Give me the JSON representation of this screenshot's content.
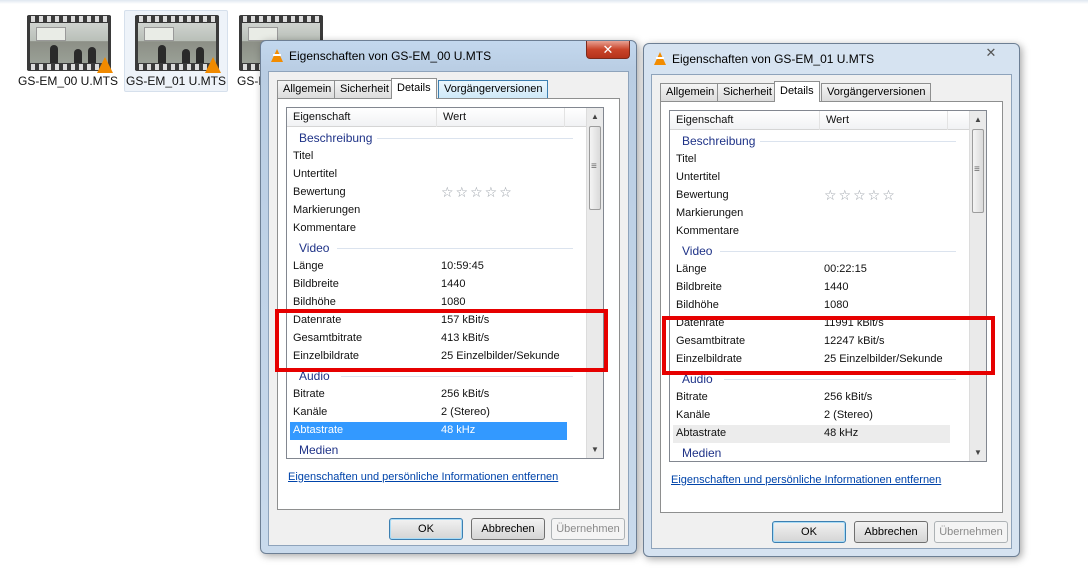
{
  "explorer": {
    "files": [
      {
        "name": "GS-EM_00 U.MTS"
      },
      {
        "name": "GS-EM_01 U.MTS"
      },
      {
        "name": "GS-E"
      }
    ]
  },
  "colors": {
    "highlight_box": "#e60000",
    "selection": "#3399ff",
    "group_header": "#1e3287",
    "link": "#0044aa"
  },
  "dialog_left": {
    "title": "Eigenschaften von GS-EM_00 U.MTS",
    "close_label": "✕",
    "tabs": [
      "Allgemein",
      "Sicherheit",
      "Details",
      "Vorgängerversionen"
    ],
    "selected_tab": "Details",
    "columns": [
      "Eigenschaft",
      "Wert"
    ],
    "groups": {
      "beschreibung": "Beschreibung",
      "video": "Video",
      "audio": "Audio",
      "medien": "Medien"
    },
    "beschreibung_rows": [
      {
        "k": "Titel",
        "v": ""
      },
      {
        "k": "Untertitel",
        "v": ""
      },
      {
        "k": "Bewertung",
        "v": ""
      },
      {
        "k": "Markierungen",
        "v": ""
      },
      {
        "k": "Kommentare",
        "v": ""
      }
    ],
    "rating_stars": "☆☆☆☆☆",
    "video_rows": [
      {
        "k": "Länge",
        "v": "10:59:45"
      },
      {
        "k": "Bildbreite",
        "v": "1440"
      },
      {
        "k": "Bildhöhe",
        "v": "1080"
      },
      {
        "k": "Datenrate",
        "v": "157 kBit/s"
      },
      {
        "k": "Gesamtbitrate",
        "v": "413 kBit/s"
      },
      {
        "k": "Einzelbildrate",
        "v": "25 Einzelbilder/Sekunde"
      }
    ],
    "audio_rows": [
      {
        "k": "Bitrate",
        "v": "256 kBit/s"
      },
      {
        "k": "Kanäle",
        "v": "2 (Stereo)"
      },
      {
        "k": "Abtastrate",
        "v": "48 kHz"
      }
    ],
    "link": "Eigenschaften und persönliche Informationen entfernen",
    "buttons": {
      "ok": "OK",
      "cancel": "Abbrechen",
      "apply": "Übernehmen"
    }
  },
  "dialog_right": {
    "title": "Eigenschaften von GS-EM_01 U.MTS",
    "close_label": "✕",
    "tabs": [
      "Allgemein",
      "Sicherheit",
      "Details",
      "Vorgängerversionen"
    ],
    "selected_tab": "Details",
    "columns": [
      "Eigenschaft",
      "Wert"
    ],
    "groups": {
      "beschreibung": "Beschreibung",
      "video": "Video",
      "audio": "Audio",
      "medien": "Medien"
    },
    "beschreibung_rows": [
      {
        "k": "Titel",
        "v": ""
      },
      {
        "k": "Untertitel",
        "v": ""
      },
      {
        "k": "Bewertung",
        "v": ""
      },
      {
        "k": "Markierungen",
        "v": ""
      },
      {
        "k": "Kommentare",
        "v": ""
      }
    ],
    "rating_stars": "☆☆☆☆☆",
    "video_rows": [
      {
        "k": "Länge",
        "v": "00:22:15"
      },
      {
        "k": "Bildbreite",
        "v": "1440"
      },
      {
        "k": "Bildhöhe",
        "v": "1080"
      },
      {
        "k": "Datenrate",
        "v": "11991 kBit/s"
      },
      {
        "k": "Gesamtbitrate",
        "v": "12247 kBit/s"
      },
      {
        "k": "Einzelbildrate",
        "v": "25 Einzelbilder/Sekunde"
      }
    ],
    "audio_rows": [
      {
        "k": "Bitrate",
        "v": "256 kBit/s"
      },
      {
        "k": "Kanäle",
        "v": "2 (Stereo)"
      },
      {
        "k": "Abtastrate",
        "v": "48 kHz"
      }
    ],
    "link": "Eigenschaften und persönliche Informationen entfernen",
    "buttons": {
      "ok": "OK",
      "cancel": "Abbrechen",
      "apply": "Übernehmen"
    }
  }
}
